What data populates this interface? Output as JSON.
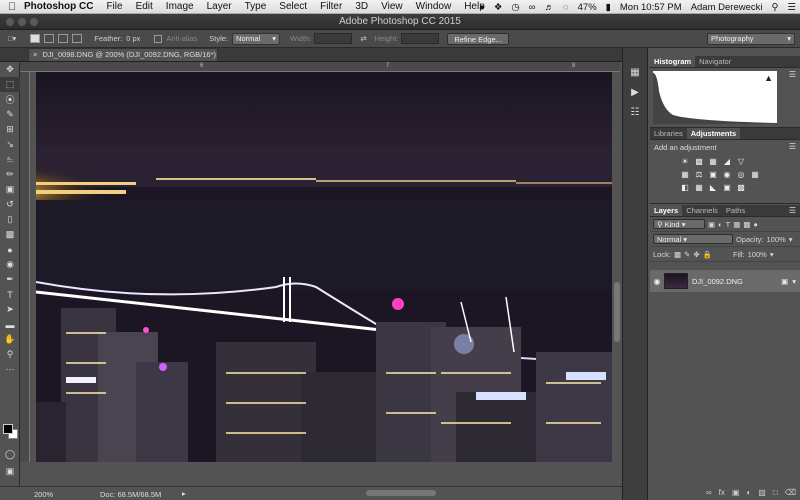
{
  "menubar": {
    "apple_icon": "apple-icon",
    "app_name": "Photoshop CC",
    "items": [
      "File",
      "Edit",
      "Image",
      "Layer",
      "Type",
      "Select",
      "Filter",
      "3D",
      "View",
      "Window",
      "Help"
    ],
    "battery": "47%",
    "clock": "Mon 10:57 PM",
    "user": "Adam Derewecki"
  },
  "window": {
    "title": "Adobe Photoshop CC 2015"
  },
  "options": {
    "feather_label": "Feather:",
    "feather_value": "0 px",
    "antialias_label": "Anti-alias",
    "style_label": "Style:",
    "style_value": "Normal",
    "width_label": "Width:",
    "height_label": "Height:",
    "refine_label": "Refine Edge...",
    "workspace_value": "Photography"
  },
  "document": {
    "tab_label": "DJI_0098.DNG @ 200% (DJI_0092.DNG, RGB/16*) *",
    "ruler_labels": [
      "6",
      "7",
      "8"
    ],
    "zoom": "200%",
    "doc_size": "Doc: 68.5M/68.5M"
  },
  "panels": {
    "histogram_tabs": [
      "Histogram",
      "Navigator"
    ],
    "adjust_tabs": [
      "Libraries",
      "Adjustments"
    ],
    "adjust_title": "Add an adjustment",
    "layer_tabs": [
      "Layers",
      "Channels",
      "Paths"
    ],
    "kind_label": "Kind",
    "blend_mode": "Normal",
    "opacity_label": "Opacity:",
    "opacity_value": "100%",
    "lock_label": "Lock:",
    "fill_label": "Fill:",
    "fill_value": "100%",
    "layer_name": "DJI_0092.DNG"
  },
  "colors": {
    "accent": "#535353",
    "panel_dark": "#3a3a3a"
  }
}
